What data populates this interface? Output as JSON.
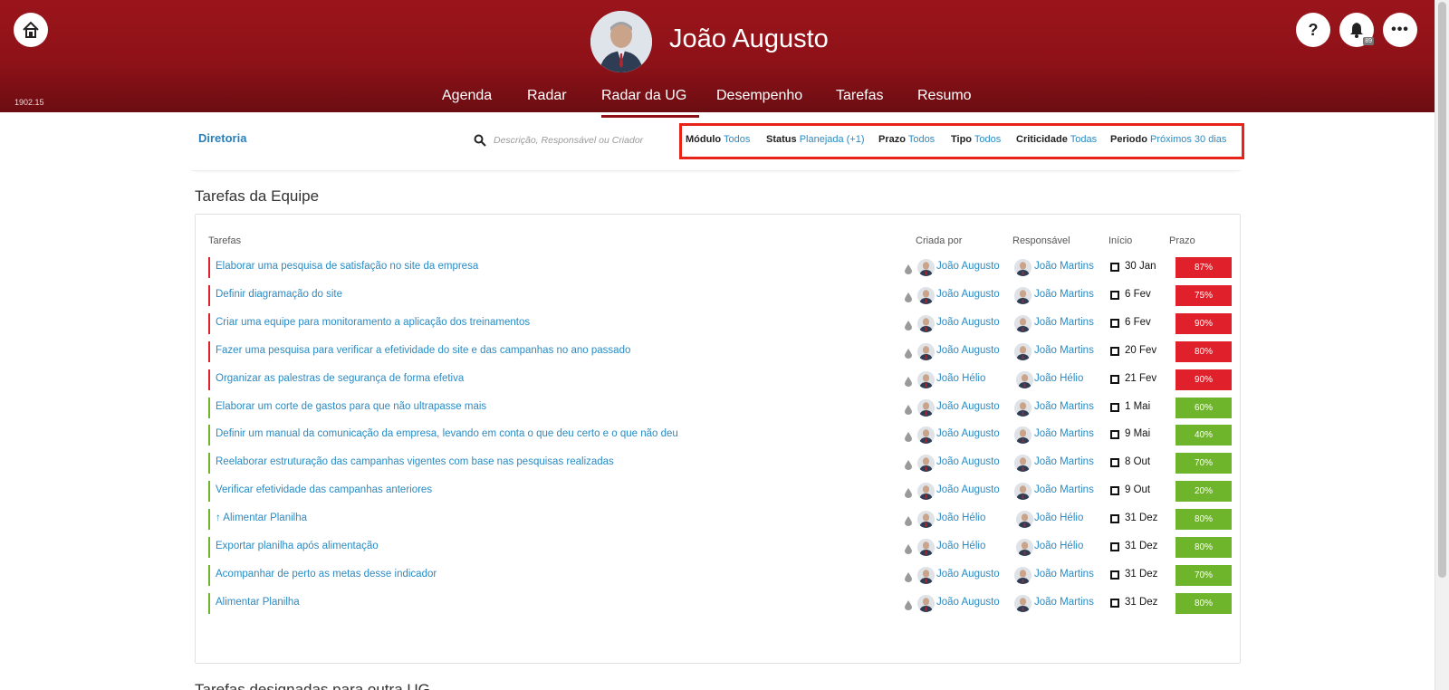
{
  "app": {
    "user_name": "João Augusto",
    "version": "1902.15",
    "notifications_count": "89",
    "help_label": "?",
    "more_label": "•••"
  },
  "nav": [
    {
      "label": "Agenda"
    },
    {
      "label": "Radar"
    },
    {
      "label": "Radar da UG",
      "active": true
    },
    {
      "label": "Desempenho"
    },
    {
      "label": "Tarefas"
    },
    {
      "label": "Resumo"
    }
  ],
  "filterbar": {
    "department": "Diretoria",
    "search_placeholder": "Descrição, Responsável ou Criador",
    "filters": [
      {
        "key": "Módulo",
        "value": "Todos"
      },
      {
        "key": "Status",
        "value": "Planejada (+1)"
      },
      {
        "key": "Prazo",
        "value": "Todos"
      },
      {
        "key": "Tipo",
        "value": "Todos"
      },
      {
        "key": "Criticidade",
        "value": "Todas"
      },
      {
        "key": "Periodo",
        "value": "Próximos 30 dias"
      }
    ]
  },
  "section": {
    "title": "Tarefas da Equipe",
    "next_title": "Tarefas designadas para outra UG"
  },
  "table": {
    "headers": {
      "task": "Tarefas",
      "created_by": "Criada por",
      "responsible": "Responsável",
      "start": "Início",
      "deadline": "Prazo"
    },
    "rows": [
      {
        "task": "Elaborar uma pesquisa de satisfação no site da empresa",
        "created_by": "João Augusto",
        "responsible": "João Martins",
        "start": "30 Jan",
        "progress": "87%",
        "status_color": "#e0202a"
      },
      {
        "task": "Definir diagramação do site",
        "created_by": "João Augusto",
        "responsible": "João Martins",
        "start": "6 Fev",
        "progress": "75%",
        "status_color": "#e0202a"
      },
      {
        "task": "Criar uma equipe para monitoramento a aplicação dos treinamentos",
        "created_by": "João Augusto",
        "responsible": "João Martins",
        "start": "6 Fev",
        "progress": "90%",
        "status_color": "#e0202a"
      },
      {
        "task": "Fazer uma pesquisa para verificar a efetividade do site e das campanhas no ano passado",
        "created_by": "João Augusto",
        "responsible": "João Martins",
        "start": "20 Fev",
        "progress": "80%",
        "status_color": "#e0202a"
      },
      {
        "task": "Organizar as palestras de segurança de forma efetiva",
        "created_by": "João Hélio",
        "responsible": "João Hélio",
        "start": "21 Fev",
        "progress": "90%",
        "status_color": "#e0202a"
      },
      {
        "task": "Elaborar um corte de gastos para que não ultrapasse mais",
        "created_by": "João Augusto",
        "responsible": "João Martins",
        "start": "1 Mai",
        "progress": "60%",
        "status_color": "#6fb52c"
      },
      {
        "task": "Definir um manual da comunicação da empresa, levando em conta o que deu certo e o que não deu",
        "created_by": "João Augusto",
        "responsible": "João Martins",
        "start": "9 Mai",
        "progress": "40%",
        "status_color": "#6fb52c"
      },
      {
        "task": "Reelaborar estruturação das campanhas vigentes com base nas pesquisas realizadas",
        "created_by": "João Augusto",
        "responsible": "João Martins",
        "start": "8 Out",
        "progress": "70%",
        "status_color": "#6fb52c"
      },
      {
        "task": "Verificar efetividade das campanhas anteriores",
        "created_by": "João Augusto",
        "responsible": "João Martins",
        "start": "9 Out",
        "progress": "20%",
        "status_color": "#6fb52c"
      },
      {
        "task": "↑ Alimentar Planilha",
        "created_by": "João Hélio",
        "responsible": "João Hélio",
        "start": "31 Dez",
        "progress": "80%",
        "status_color": "#6fb52c"
      },
      {
        "task": "Exportar planilha após alimentação",
        "created_by": "João Hélio",
        "responsible": "João Hélio",
        "start": "31 Dez",
        "progress": "80%",
        "status_color": "#6fb52c"
      },
      {
        "task": "Acompanhar de perto as metas desse indicador",
        "created_by": "João Augusto",
        "responsible": "João Martins",
        "start": "31 Dez",
        "progress": "70%",
        "status_color": "#6fb52c"
      },
      {
        "task": "Alimentar Planilha",
        "created_by": "João Augusto",
        "responsible": "João Martins",
        "start": "31 Dez",
        "progress": "80%",
        "status_color": "#6fb52c"
      }
    ]
  },
  "colors": {
    "header_red": "#8e1218",
    "link_blue": "#2a8bc4",
    "late_red": "#e0202a",
    "ok_green": "#6fb52c",
    "highlight_box": "#e8231a"
  }
}
